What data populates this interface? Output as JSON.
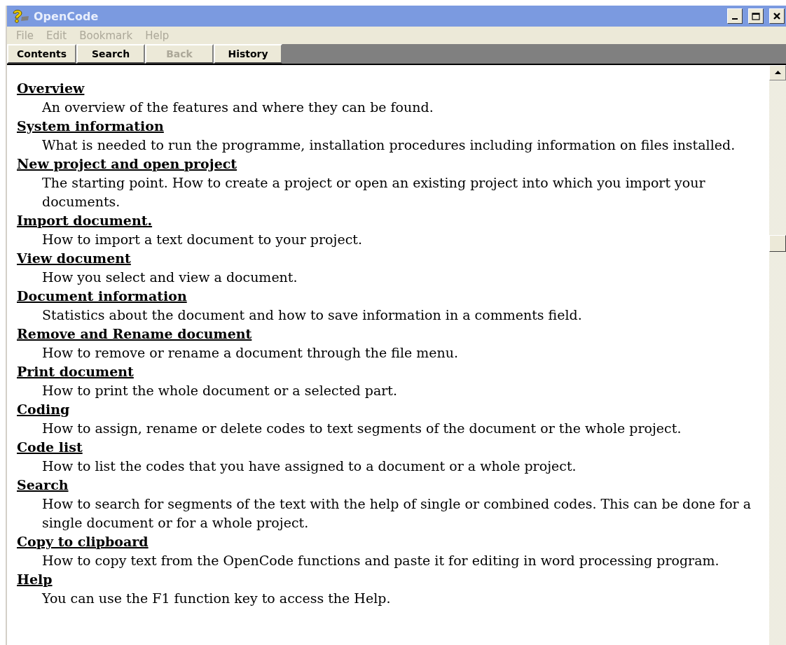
{
  "window": {
    "title": "OpenCode"
  },
  "menu": [
    {
      "label": "File",
      "disabled": true
    },
    {
      "label": "Edit",
      "disabled": true
    },
    {
      "label": "Bookmark",
      "disabled": true
    },
    {
      "label": "Help",
      "disabled": true
    }
  ],
  "tabs": [
    {
      "label": "Contents",
      "disabled": false
    },
    {
      "label": "Search",
      "disabled": false
    },
    {
      "label": "Back",
      "disabled": true
    },
    {
      "label": "History",
      "disabled": false
    }
  ],
  "topics": [
    {
      "title": "Overview",
      "description": "An overview of the features and where they can be found."
    },
    {
      "title": "System information",
      "description": "What is needed to run the programme, installation procedures including information on files installed."
    },
    {
      "title": "New project and open project",
      "description": "The starting point. How to create a project or open an existing project into which you import your documents."
    },
    {
      "title": "Import document.",
      "description": "How to import a text document to your project."
    },
    {
      "title": "View document",
      "description": "How you select and view a document."
    },
    {
      "title": "Document information",
      "description": "Statistics about the document and how to save information in a comments field."
    },
    {
      "title": "Remove and Rename document",
      "description": "How to remove or rename a document through the file menu."
    },
    {
      "title": "Print document",
      "description": "How to print the whole document or a selected part."
    },
    {
      "title": "Coding",
      "description": "How to assign, rename or delete codes to text segments of the document or the whole project."
    },
    {
      "title": "Code list",
      "description": "How to list the codes that you have assigned to a document or a whole project."
    },
    {
      "title": "Search",
      "description": "How to search for segments of the text with the help of single or combined codes. This can be done for a single document or for a whole project."
    },
    {
      "title": "Copy to clipboard",
      "description": "How to copy text from the OpenCode functions and paste it for editing in word processing program."
    },
    {
      "title": "Help",
      "description": "You can use the F1 function key to access the Help."
    }
  ]
}
